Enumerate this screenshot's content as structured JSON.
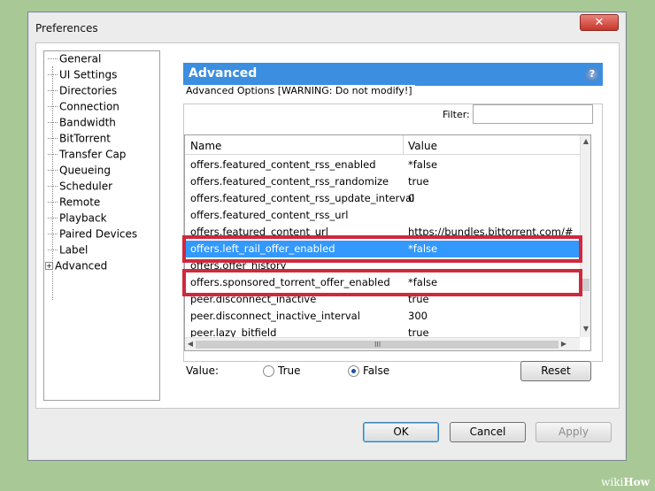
{
  "window": {
    "title": "Preferences",
    "close_glyph": "✕"
  },
  "sidebar": {
    "items": [
      {
        "label": "General"
      },
      {
        "label": "UI Settings"
      },
      {
        "label": "Directories"
      },
      {
        "label": "Connection"
      },
      {
        "label": "Bandwidth"
      },
      {
        "label": "BitTorrent"
      },
      {
        "label": "Transfer Cap"
      },
      {
        "label": "Queueing"
      },
      {
        "label": "Scheduler"
      },
      {
        "label": "Remote"
      },
      {
        "label": "Playback"
      },
      {
        "label": "Paired Devices"
      },
      {
        "label": "Label"
      },
      {
        "label": "Advanced"
      }
    ],
    "expander_glyph": "+"
  },
  "panel": {
    "title": "Advanced",
    "help_glyph": "?",
    "group_label": "Advanced Options [WARNING: Do not modify!]",
    "filter_label": "Filter:",
    "filter_value": ""
  },
  "list": {
    "headers": {
      "name": "Name",
      "value": "Value"
    },
    "rows": [
      {
        "name": "offers.featured_content_rss_enabled",
        "value": "*false"
      },
      {
        "name": "offers.featured_content_rss_randomize",
        "value": "true"
      },
      {
        "name": "offers.featured_content_rss_update_interval",
        "value": "0"
      },
      {
        "name": "offers.featured_content_rss_url",
        "value": ""
      },
      {
        "name": "offers.featured_content_url",
        "value": "https://bundles.bittorrent.com/#"
      },
      {
        "name": "offers.left_rail_offer_enabled",
        "value": "*false"
      },
      {
        "name": "offers.offer_history",
        "value": ""
      },
      {
        "name": "offers.sponsored_torrent_offer_enabled",
        "value": "*false"
      },
      {
        "name": "peer.disconnect_inactive",
        "value": "true"
      },
      {
        "name": "peer.disconnect_inactive_interval",
        "value": "300"
      },
      {
        "name": "peer.lazy_bitfield",
        "value": "true"
      }
    ],
    "selected_index": 5,
    "scroll_up_glyph": "▲",
    "scroll_down_glyph": "▼",
    "scroll_left_glyph": "◀",
    "scroll_right_glyph": "▶",
    "grip_glyph": "III"
  },
  "value_editor": {
    "label": "Value:",
    "true_label": "True",
    "false_label": "False",
    "selected": "False",
    "reset_label": "Reset"
  },
  "footer": {
    "ok_label": "OK",
    "cancel_label": "Cancel",
    "apply_label": "Apply"
  },
  "watermark": {
    "prefix": "wiki",
    "suffix": "How"
  },
  "colors": {
    "selection": "#3399ff",
    "highlight_box": "#d0283c",
    "header": "#3b8ee0"
  }
}
